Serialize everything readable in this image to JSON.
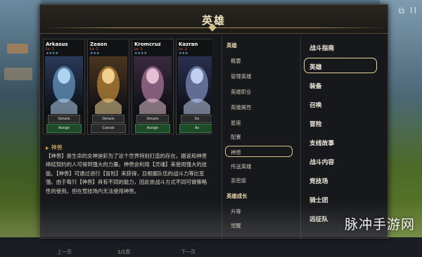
{
  "colors": {
    "accent_gold": "#e9d39c",
    "assign_green": "#1e4b2a",
    "level_red": "#e66"
  },
  "header": {
    "title": "英雄",
    "corner_icons": "⧉ II"
  },
  "cards": [
    {
      "name": "Arkasus",
      "level": "Lv. 1",
      "stars": "★★★★",
      "details": "Details",
      "action": "Assign",
      "action_kind": "assign"
    },
    {
      "name": "Zeaon",
      "level": "Lv. 1",
      "stars": "★★★",
      "details": "Details",
      "action": "Cancel",
      "action_kind": "cancel"
    },
    {
      "name": "Kromcruz",
      "level": "Lv. 1",
      "stars": "★★★★",
      "details": "Details",
      "action": "Assign",
      "action_kind": "assign"
    },
    {
      "name": "Kazran",
      "level": "Lv. 1",
      "stars": "★★★",
      "details": "De",
      "action": "As",
      "action_kind": "assign"
    }
  ],
  "section": {
    "title": "神兽"
  },
  "description": "【神兽】是生命的女神迪彩为了这个世界特别打造的存在。据说和神兽缔结契约的人可得到强大的力量。神兽会利用【灵魂】来使用强大的技能。【神兽】可通过进行【冒险】来获得，且根据队伍的战斗力等比变强。由于每只【神兽】具有不同的能力，因此依战斗方式不同可做策略性的使用。但在竞技场内无法使用神兽。",
  "pager": {
    "prev": "上一页",
    "page": "1/1页",
    "next": "下一页"
  },
  "mid_nav": {
    "items": [
      {
        "label": "英雄",
        "head": true
      },
      {
        "label": "概要"
      },
      {
        "label": "管理英雄"
      },
      {
        "label": "英雄职业"
      },
      {
        "label": "英雄属性"
      },
      {
        "label": "星座"
      },
      {
        "label": "配置"
      },
      {
        "label": "神兽",
        "active": true
      },
      {
        "label": "传送英雄"
      },
      {
        "label": "亲密度"
      },
      {
        "label": "英雄成长",
        "head": true
      },
      {
        "label": "升等"
      },
      {
        "label": "觉醒"
      }
    ]
  },
  "right_nav": {
    "items": [
      {
        "label": "战斗指南"
      },
      {
        "label": "英雄",
        "active": true
      },
      {
        "label": "装备"
      },
      {
        "label": "召唤"
      },
      {
        "label": "冒险"
      },
      {
        "label": "支线故事"
      },
      {
        "label": "战斗内容"
      },
      {
        "label": "竞技场"
      },
      {
        "label": "骑士团"
      },
      {
        "label": "远征队"
      }
    ]
  },
  "watermark": "脉冲手游网"
}
